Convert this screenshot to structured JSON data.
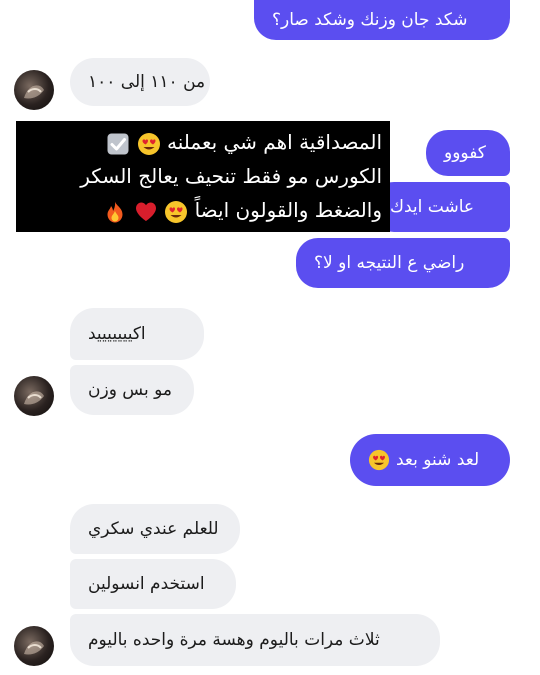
{
  "messages": [
    {
      "text": "شكد جان وزنك وشكد صار؟",
      "emoji": ""
    },
    {
      "text": "من ١١٠ إلى ١٠٠",
      "emoji": ""
    },
    {
      "text": "كفووو",
      "emoji": ""
    },
    {
      "text": "عاشت ايدك",
      "emoji": ""
    },
    {
      "text": "راضي ع النتيجه او لا؟",
      "emoji": ""
    },
    {
      "text": "اكيييييييد",
      "emoji": ""
    },
    {
      "text": "مو بس وزن",
      "emoji": ""
    },
    {
      "text": "لعد شنو بعد",
      "emoji": "heart-eyes-emoji"
    },
    {
      "text": "للعلم عندي سكري",
      "emoji": ""
    },
    {
      "text": "استخدم انسولين",
      "emoji": ""
    },
    {
      "text": "ثلاث مرات باليوم وهسة مرة واحده باليوم",
      "emoji": ""
    }
  ],
  "overlay": {
    "line1": "المصداقية اهم شي بعملنه",
    "line1_emojis": [
      "heart-eyes-emoji",
      "check-box-emoji"
    ],
    "line2": "الكورس مو فقط تنحيف يعالج السكر",
    "line3": "والضغط والقولون ايضاً",
    "line3_emojis": [
      "heart-eyes-emoji",
      "red-heart-emoji",
      "fire-emoji"
    ]
  },
  "colors": {
    "outgoing_bubble": "#5b4ef0",
    "incoming_bubble": "#eeeff2",
    "overlay_background": "#000000"
  }
}
